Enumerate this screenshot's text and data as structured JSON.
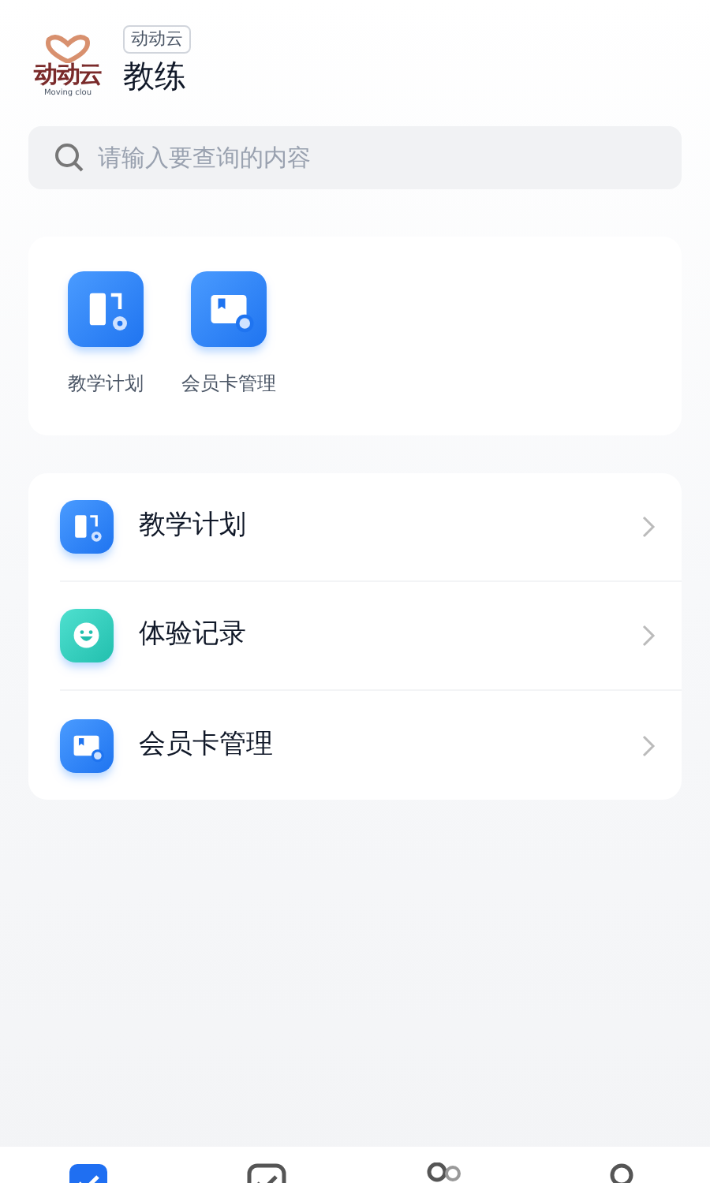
{
  "header": {
    "logo_text": "动动云",
    "logo_subtext": "Moving clou",
    "tag": "动动云",
    "title": "教练"
  },
  "search": {
    "placeholder": "请输入要查询的内容"
  },
  "shortcuts": [
    {
      "kind": "plan",
      "label": "教学计划"
    },
    {
      "kind": "card",
      "label": "会员卡管理"
    }
  ],
  "menu": [
    {
      "kind": "plan",
      "label": "教学计划"
    },
    {
      "kind": "smile",
      "label": "体验记录"
    },
    {
      "kind": "card",
      "label": "会员卡管理"
    }
  ],
  "tab_bar": [
    {
      "kind": "check",
      "selected": true
    },
    {
      "kind": "checkbox",
      "selected": false
    },
    {
      "kind": "people",
      "selected": false
    },
    {
      "kind": "person",
      "selected": false
    }
  ]
}
